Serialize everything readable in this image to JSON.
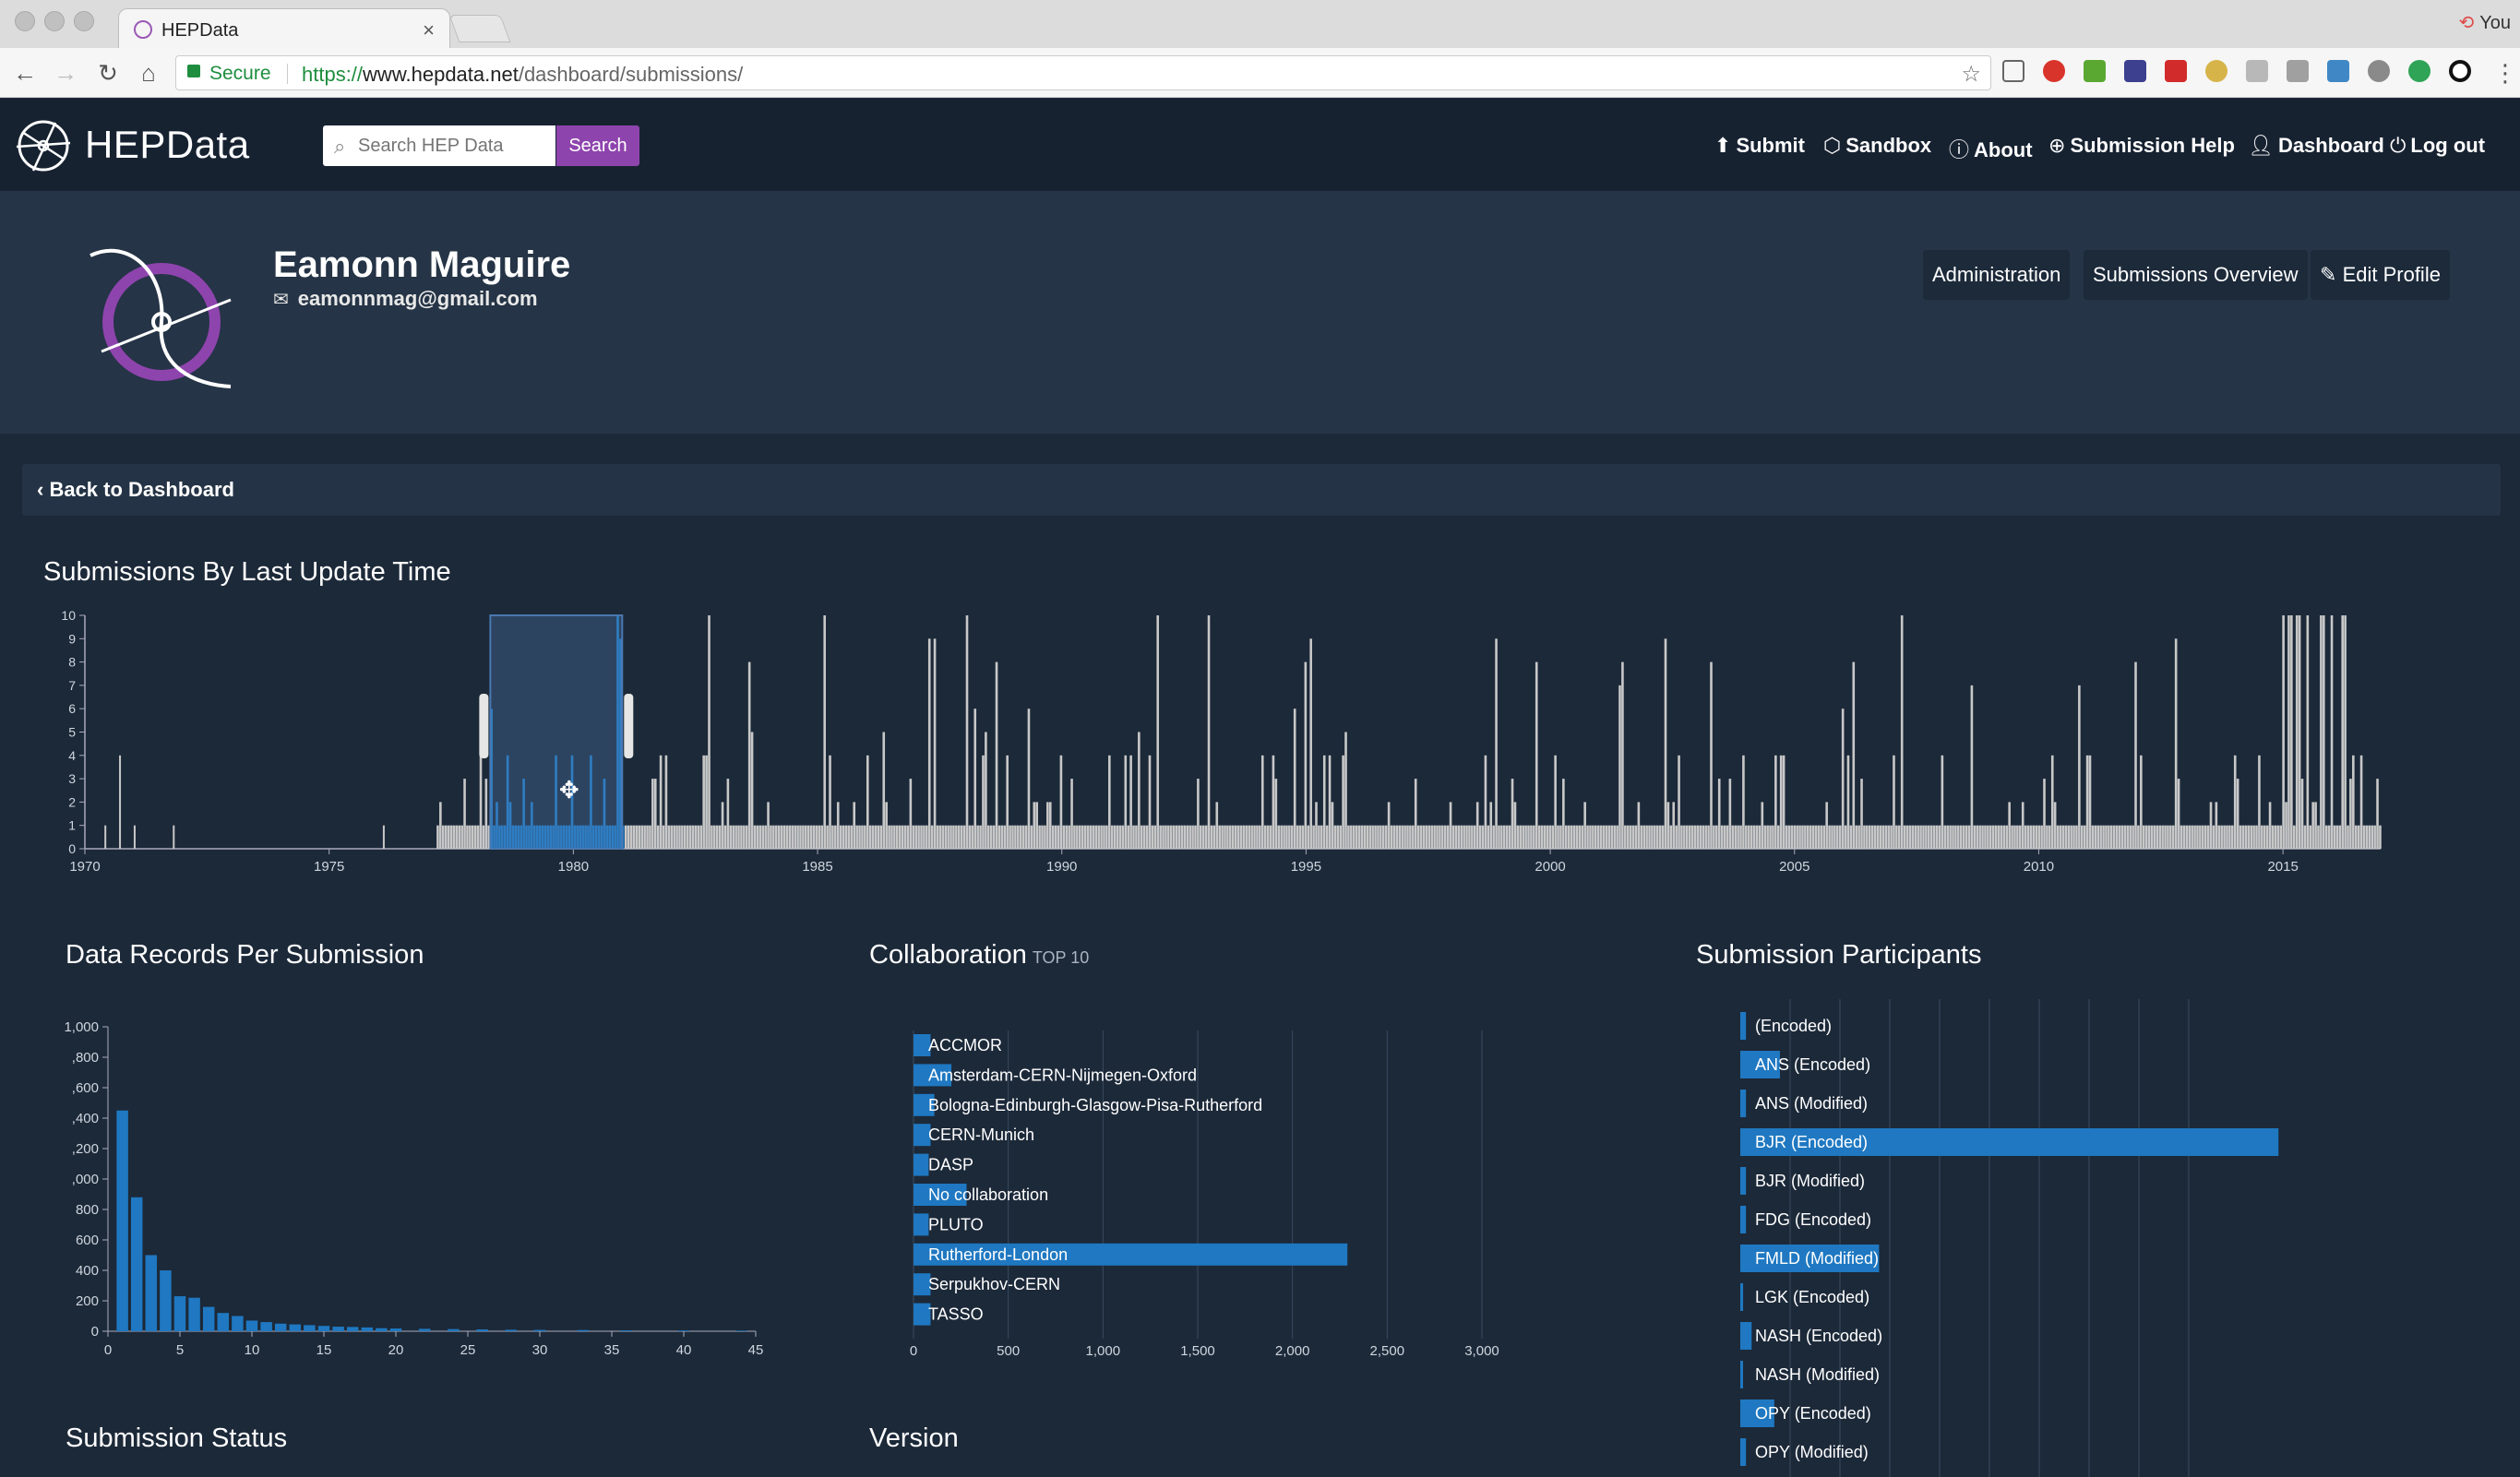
{
  "browser": {
    "tab_title": "HEPData",
    "tab_close": "×",
    "profile_name": "You",
    "secure_label": "Secure",
    "url_scheme": "https://",
    "url_host": "www.hepdata.net",
    "url_path": "/dashboard/submissions/"
  },
  "nav": {
    "logo_text": "HEPData",
    "search_placeholder": "Search HEP Data",
    "search_button": "Search",
    "links": [
      {
        "label": "Submit",
        "icon": "upload-icon"
      },
      {
        "label": "Sandbox",
        "icon": "cube-icon"
      },
      {
        "label": "About",
        "icon": "info-icon"
      },
      {
        "label": "Submission Help",
        "icon": "lifebuoy-icon"
      },
      {
        "label": "Dashboard",
        "icon": "user-icon"
      },
      {
        "label": "Log out",
        "icon": "power-icon"
      }
    ]
  },
  "profile": {
    "name": "Eamonn Maguire",
    "email": "eamonnmag@gmail.com",
    "buttons": {
      "administration": "Administration",
      "overview": "Submissions Overview",
      "edit": "Edit Profile"
    }
  },
  "back_link": "Back to Dashboard",
  "colors": {
    "accent_purple": "#8e44ad",
    "bar_blue": "#1f78c1",
    "bar_grey": "#c8c8c8",
    "background": "#1c2939"
  },
  "charts": {
    "timeline_title": "Submissions By Last Update Time",
    "records_title": "Data Records Per Submission",
    "collab_title": "Collaboration",
    "collab_subtitle": "TOP 10",
    "participants_title": "Submission Participants",
    "status_title": "Submission Status",
    "version_title": "Version"
  },
  "chart_data": [
    {
      "id": "timeline",
      "type": "bar",
      "title": "Submissions By Last Update Time",
      "x_ticks": [
        "1970",
        "1975",
        "1980",
        "1985",
        "1990",
        "1995",
        "2000",
        "2005",
        "2010",
        "2015"
      ],
      "y_ticks": [
        0,
        1,
        2,
        3,
        4,
        5,
        6,
        7,
        8,
        9,
        10
      ],
      "xlim": [
        1970,
        2017
      ],
      "ylim": [
        0,
        10
      ],
      "brush_selection": [
        1978.3,
        1981.0
      ]
    },
    {
      "id": "records",
      "type": "bar",
      "title": "Data Records Per Submission",
      "x": [
        1,
        2,
        3,
        4,
        5,
        6,
        7,
        8,
        9,
        10,
        11,
        12,
        13,
        14,
        15,
        16,
        17,
        18,
        19,
        20,
        22,
        24,
        26,
        28,
        30,
        33,
        36,
        40,
        44
      ],
      "values": [
        1450,
        880,
        500,
        400,
        230,
        220,
        160,
        120,
        100,
        70,
        60,
        50,
        45,
        40,
        35,
        30,
        28,
        25,
        20,
        18,
        16,
        14,
        12,
        10,
        9,
        8,
        6,
        5,
        4
      ],
      "x_ticks": [
        "0",
        "5",
        "10",
        "15",
        "20",
        "25",
        "30",
        "35",
        "40",
        "45"
      ],
      "y_ticks": [
        "0",
        "200",
        "400",
        "600",
        "800",
        ",000",
        ",200",
        ",400",
        ",600",
        ",800",
        "1,000"
      ],
      "ylim": [
        0,
        2000
      ],
      "xlim": [
        0,
        45
      ]
    },
    {
      "id": "collaboration",
      "type": "bar",
      "orientation": "horizontal",
      "title": "Collaboration",
      "subtitle": "TOP 10",
      "categories": [
        "ACCMOR",
        "Amsterdam-CERN-Nijmegen-Oxford",
        "Bologna-Edinburgh-Glasgow-Pisa-Rutherford",
        "CERN-Munich",
        "DASP",
        "No collaboration",
        "PLUTO",
        "Rutherford-London",
        "Serpukhov-CERN",
        "TASSO"
      ],
      "values": [
        90,
        200,
        110,
        90,
        80,
        280,
        80,
        2290,
        90,
        90
      ],
      "x_ticks": [
        "0",
        "500",
        "1,000",
        "1,500",
        "2,000",
        "2,500",
        "3,000"
      ],
      "xlim": [
        0,
        3000
      ]
    },
    {
      "id": "participants",
      "type": "bar",
      "orientation": "horizontal",
      "title": "Submission Participants",
      "categories": [
        "(Encoded)",
        "ANS (Encoded)",
        "ANS (Modified)",
        "BJR (Encoded)",
        "BJR (Modified)",
        "FDG (Encoded)",
        "FMLD (Modified)",
        "LGK (Encoded)",
        "NASH (Encoded)",
        "NASH (Modified)",
        "OPY (Encoded)",
        "OPY (Modified)"
      ],
      "values": [
        4,
        28,
        4,
        380,
        4,
        4,
        98,
        2,
        8,
        1,
        24,
        4
      ],
      "xlim": [
        0,
        430
      ]
    }
  ]
}
